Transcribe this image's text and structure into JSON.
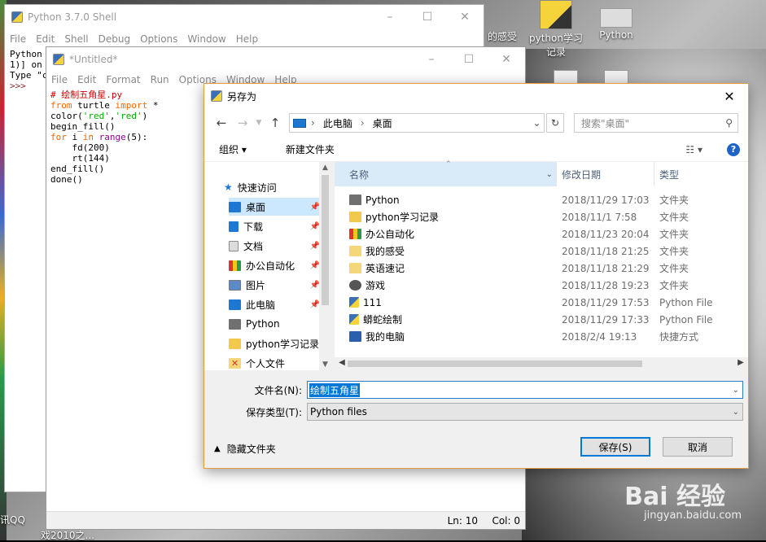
{
  "desktop": {
    "icons": [
      {
        "label": "的感受"
      },
      {
        "label": "python学习\n记录"
      },
      {
        "label": "Python"
      }
    ],
    "bottom_left_text": "讯QQ",
    "bottom_left_text2": "戏2010之...",
    "watermark": "Bai 经验",
    "watermark_sub": "jingyan.baidu.com"
  },
  "shell": {
    "title": "Python 3.7.0 Shell",
    "menu": [
      "File",
      "Edit",
      "Shell",
      "Debug",
      "Options",
      "Window",
      "Help"
    ],
    "lines": [
      "Python",
      "1)] on",
      "Type \"c"
    ],
    "prompt": ">>>"
  },
  "editor": {
    "title": "*Untitled*",
    "menu": [
      "File",
      "Edit",
      "Format",
      "Run",
      "Options",
      "Window",
      "Help"
    ],
    "code": {
      "comment": "# 绘制五角星.py",
      "line2_kw1": "from",
      "line2_mod": " turtle ",
      "line2_kw2": "import",
      "line2_rest": " *",
      "line3_a": "color(",
      "line3_s1": "'red'",
      "line3_b": ",",
      "line3_s2": "'red'",
      "line3_c": ")",
      "line4": "begin_fill()",
      "line5_kw": "for",
      "line5_a": " i ",
      "line5_kw2": "in",
      "line5_b": " ",
      "line5_builtin": "range",
      "line5_c": "(5):",
      "line6": "    fd(200)",
      "line7": "    rt(144)",
      "line8": "end_fill()",
      "line9": "done()"
    },
    "status": {
      "line": "Ln: 10",
      "col": "Col: 0"
    }
  },
  "dialog": {
    "title": "另存为",
    "close": "✕",
    "address": {
      "seg1": "此电脑",
      "seg2": "桌面"
    },
    "search_placeholder": "搜索\"桌面\"",
    "toolbar": {
      "organize": "组织 ▾",
      "new_folder": "新建文件夹",
      "help": "?"
    },
    "nav": {
      "quick_access": "快速访问",
      "items": [
        {
          "label": "桌面",
          "pinned": true,
          "color": "#1e78d2"
        },
        {
          "label": "下载",
          "pinned": true,
          "color": "#1e78d2"
        },
        {
          "label": "文档",
          "pinned": true,
          "color": "#8c8c8c"
        },
        {
          "label": "办公自动化",
          "pinned": true,
          "color": "#d33"
        },
        {
          "label": "图片",
          "pinned": true,
          "color": "#5a8ac8"
        },
        {
          "label": "此电脑",
          "pinned": true,
          "color": "#1e78d2"
        },
        {
          "label": "Python",
          "pinned": false,
          "color": "#707070"
        },
        {
          "label": "python学习记录",
          "pinned": false,
          "color": "#f2c94c"
        },
        {
          "label": "个人文件",
          "pinned": false,
          "color": "#e03030"
        }
      ]
    },
    "columns": {
      "name": "名称",
      "date": "修改日期",
      "type": "类型"
    },
    "files": [
      {
        "name": "Python",
        "date": "2018/11/29 17:03",
        "type": "文件夹",
        "color": "#707070"
      },
      {
        "name": "python学习记录",
        "date": "2018/11/1 7:58",
        "type": "文件夹",
        "color": "#f2c94c"
      },
      {
        "name": "办公自动化",
        "date": "2018/11/23 20:04",
        "type": "文件夹",
        "color": "#d33"
      },
      {
        "name": "我的感受",
        "date": "2018/11/18 21:25",
        "type": "文件夹",
        "color": "#f5d77a"
      },
      {
        "name": "英语速记",
        "date": "2018/11/18 21:29",
        "type": "文件夹",
        "color": "#f5d77a"
      },
      {
        "name": "游戏",
        "date": "2018/11/28 19:23",
        "type": "文件夹",
        "color": "#555"
      },
      {
        "name": "111",
        "date": "2018/11/29 17:53",
        "type": "Python File",
        "color": "#3b6fb6"
      },
      {
        "name": "蟒蛇绘制",
        "date": "2018/11/29 17:33",
        "type": "Python File",
        "color": "#3b6fb6"
      },
      {
        "name": "我的电脑",
        "date": "2018/2/4 19:13",
        "type": "快捷方式",
        "color": "#2a5fb0"
      }
    ],
    "filename_label": "文件名(N):",
    "filename_value": "绘制五角星",
    "filetype_label": "保存类型(T):",
    "filetype_value": "Python files",
    "hide_folders": "隐藏文件夹",
    "save_button": "保存(S)",
    "cancel_button": "取消"
  }
}
